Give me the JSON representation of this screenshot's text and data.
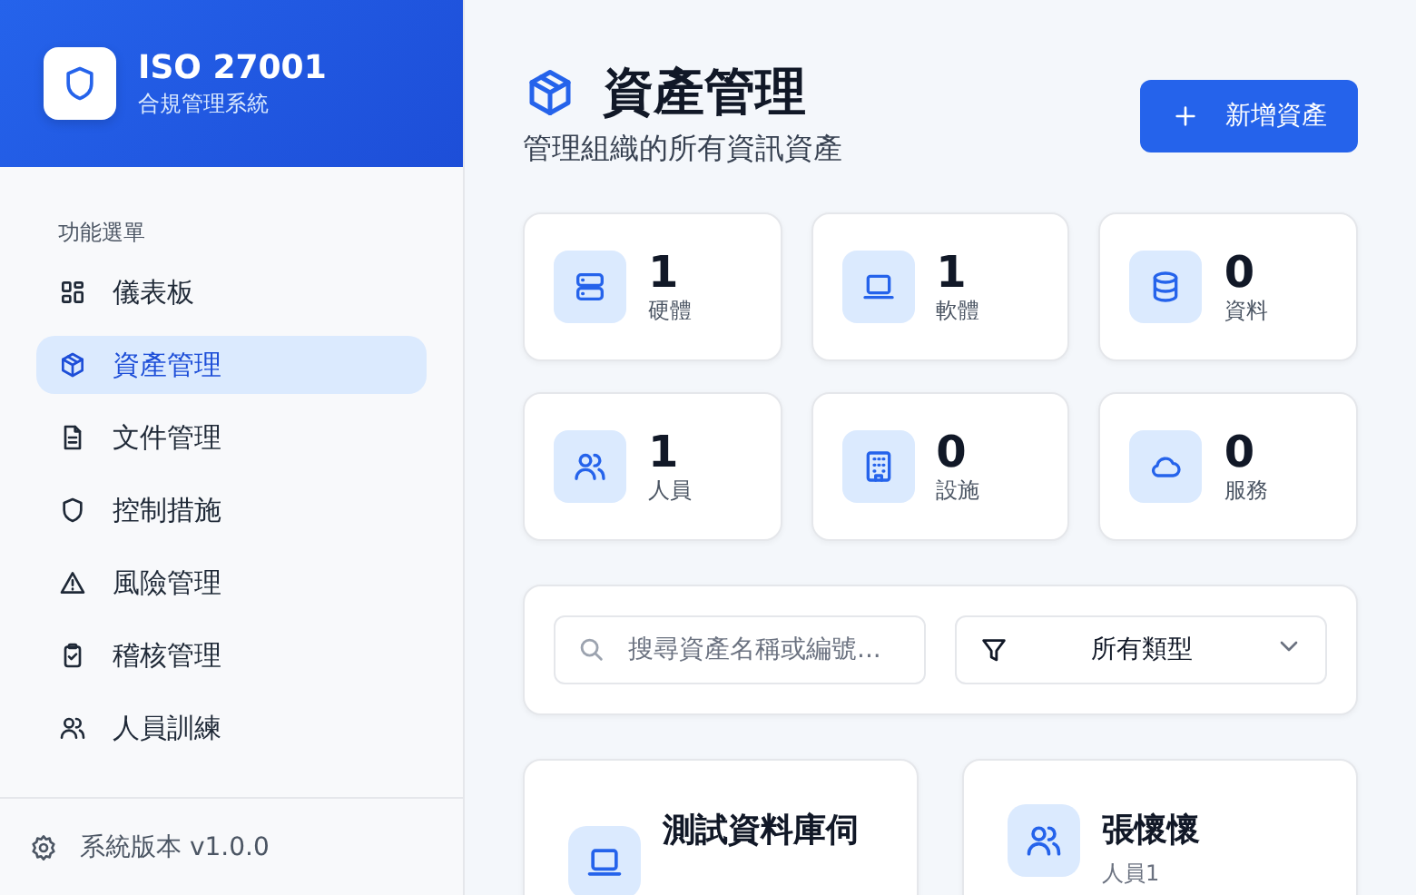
{
  "sidebar": {
    "brand": {
      "title": "ISO 27001",
      "subtitle": "合規管理系統"
    },
    "section_label": "功能選單",
    "items": [
      {
        "label": "儀表板",
        "kind": "grid",
        "selected": false
      },
      {
        "label": "資產管理",
        "kind": "box",
        "selected": true
      },
      {
        "label": "文件管理",
        "kind": "file",
        "selected": false
      },
      {
        "label": "控制措施",
        "kind": "shield",
        "selected": false
      },
      {
        "label": "風險管理",
        "kind": "warning",
        "selected": false
      },
      {
        "label": "稽核管理",
        "kind": "clipboard",
        "selected": false
      },
      {
        "label": "人員訓練",
        "kind": "users",
        "selected": false
      }
    ],
    "footer": "系統版本 v1.0.0"
  },
  "header": {
    "title": "資產管理",
    "subtitle": "管理組織的所有資訊資產",
    "add_button": "新增資產"
  },
  "stats": [
    {
      "kind": "server",
      "value": "1",
      "label": "硬體"
    },
    {
      "kind": "laptop",
      "value": "1",
      "label": "軟體"
    },
    {
      "kind": "database",
      "value": "0",
      "label": "資料"
    },
    {
      "kind": "users",
      "value": "1",
      "label": "人員"
    },
    {
      "kind": "building",
      "value": "0",
      "label": "設施"
    },
    {
      "kind": "cloud",
      "value": "0",
      "label": "服務"
    }
  ],
  "filters": {
    "search": {
      "placeholder": "搜尋資產名稱或編號..."
    },
    "type_select": "所有類型"
  },
  "assets": [
    {
      "kind": "laptop",
      "name": "測試資料庫伺"
    },
    {
      "kind": "users",
      "name": "張懷懷",
      "subtitle": "人員1"
    }
  ]
}
